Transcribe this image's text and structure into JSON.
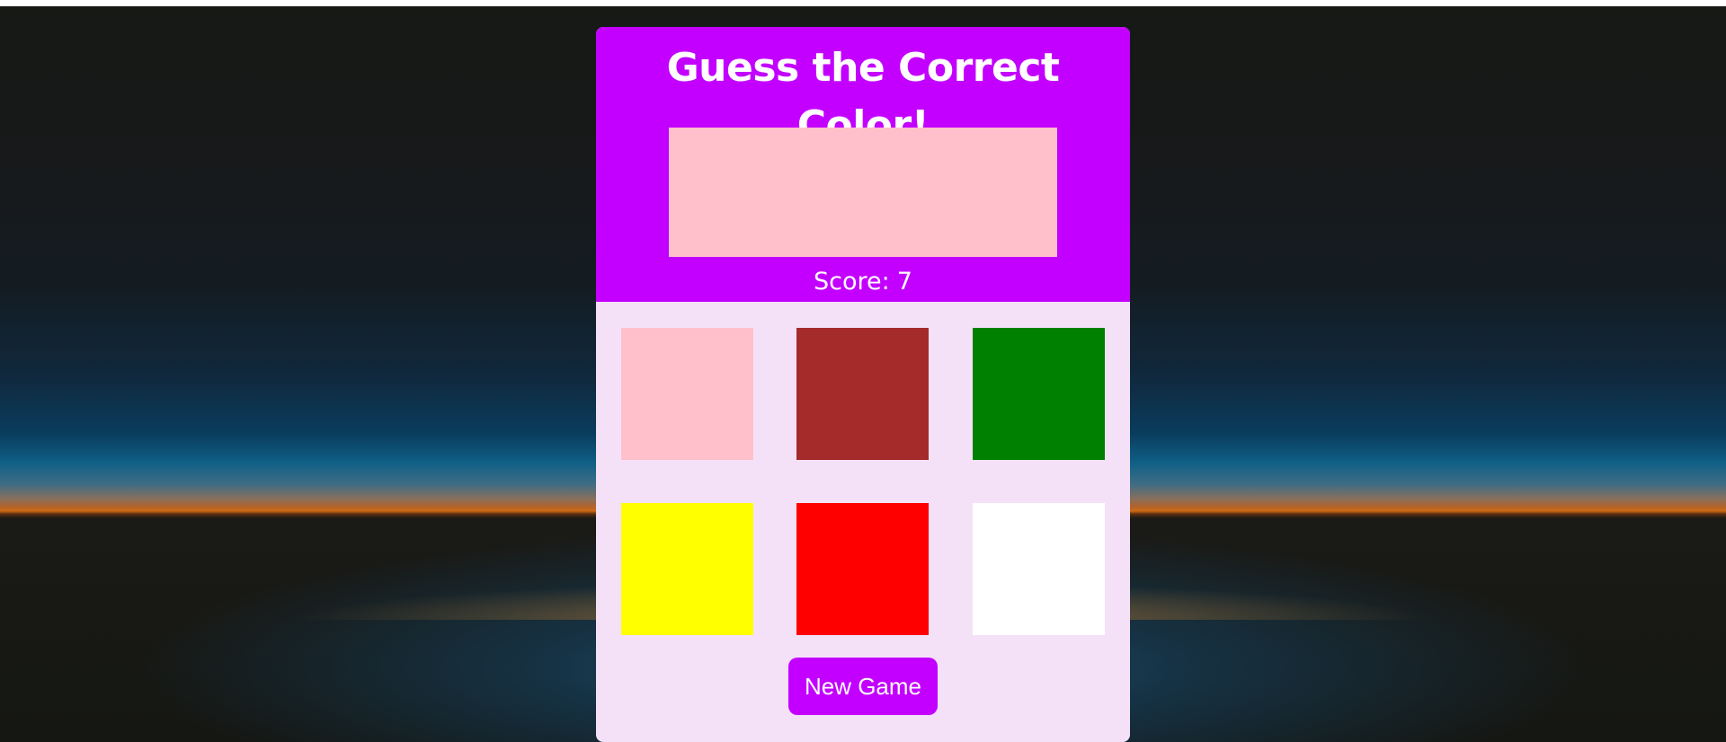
{
  "game": {
    "title": "Guess the Correct Color!",
    "target_color": "#ffc0cb",
    "score_label": "Score:",
    "score_value": "7",
    "new_game_label": "New Game",
    "options": [
      {
        "name": "pink",
        "color": "#ffc0cb"
      },
      {
        "name": "brown",
        "color": "#a52a2a"
      },
      {
        "name": "green",
        "color": "#008000"
      },
      {
        "name": "yellow",
        "color": "#ffff00"
      },
      {
        "name": "red",
        "color": "#ff0000"
      },
      {
        "name": "white",
        "color": "#ffffff"
      }
    ]
  },
  "theme": {
    "accent": "#c300ff",
    "panel_background": "#f4e1f8",
    "text_color": "#ffffff"
  }
}
